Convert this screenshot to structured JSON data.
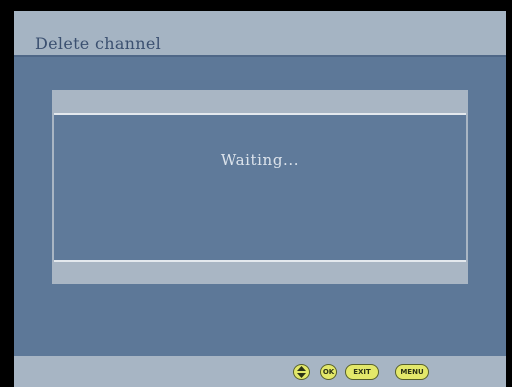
{
  "screen": {
    "title": "Delete channel"
  },
  "dialog": {
    "message": "Waiting..."
  },
  "footer": {
    "keys": [
      {
        "name": "up-down-key",
        "label": "",
        "icon": "up-down-arrows-icon"
      },
      {
        "name": "ok-key",
        "label": "OK"
      },
      {
        "name": "exit-key",
        "label": "EXIT"
      },
      {
        "name": "menu-key",
        "label": "MENU"
      }
    ],
    "key_color": "#e3e86a"
  },
  "colors": {
    "background": "#5d7898",
    "title_bar": "#a5b4c3",
    "title_text": "#3b5070",
    "dialog_frame": "#a9b6c4",
    "dialog_body": "#5f7a9a"
  }
}
